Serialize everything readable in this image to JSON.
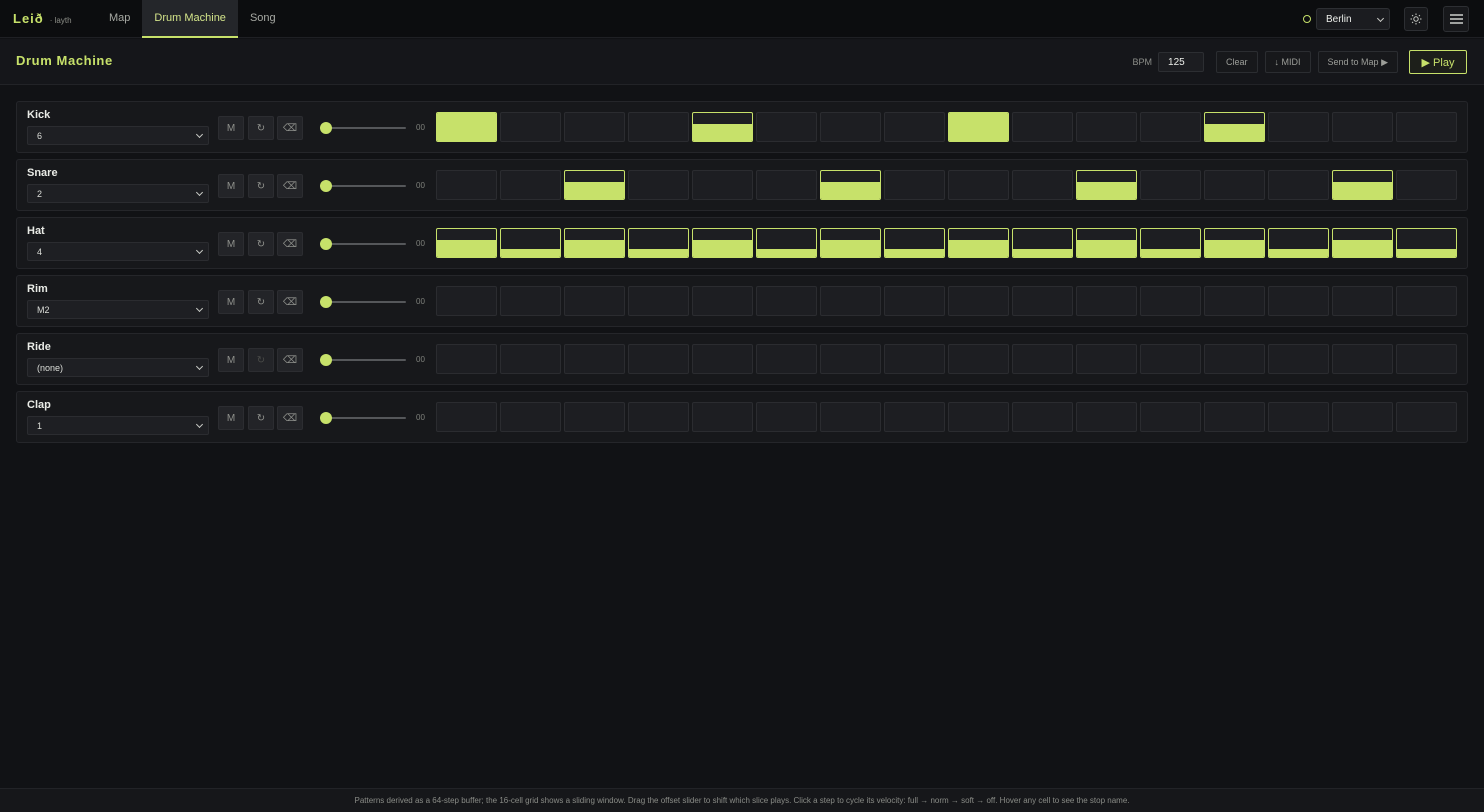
{
  "app": {
    "logo": "Leið",
    "logo_sub": "· layth"
  },
  "nav": {
    "tabs": [
      {
        "label": "Map",
        "active": false
      },
      {
        "label": "Drum Machine",
        "active": true
      },
      {
        "label": "Song",
        "active": false
      }
    ]
  },
  "city": {
    "selected": "Berlin"
  },
  "page": {
    "title": "Drum Machine"
  },
  "controls": {
    "bpm_label": "BPM",
    "bpm_value": "125",
    "clear_label": "Clear",
    "midi_label": "↓ MIDI",
    "send_label": "Send to Map ▶",
    "play_label": "▶ Play"
  },
  "colors": {
    "accent": "#c7e16a",
    "background": "#111215"
  },
  "tracks": [
    {
      "name": "Kick",
      "selected": "6",
      "mute": "M",
      "loop": "↻",
      "clear": "⌫",
      "loop_enabled": true,
      "offset": "00",
      "offset_fraction": 0.0,
      "steps": [
        1,
        0,
        0,
        0,
        0.6,
        0,
        0,
        0,
        1,
        0,
        0,
        0,
        0.6,
        0,
        0,
        0
      ]
    },
    {
      "name": "Snare",
      "selected": "2",
      "mute": "M",
      "loop": "↻",
      "clear": "⌫",
      "loop_enabled": true,
      "offset": "00",
      "offset_fraction": 0.0,
      "steps": [
        0,
        0,
        0.6,
        0,
        0,
        0,
        0.6,
        0,
        0,
        0,
        0.6,
        0,
        0,
        0,
        0.6,
        0
      ]
    },
    {
      "name": "Hat",
      "selected": "4",
      "mute": "M",
      "loop": "↻",
      "clear": "⌫",
      "loop_enabled": true,
      "offset": "00",
      "offset_fraction": 0.0,
      "steps": [
        0.6,
        0.3,
        0.6,
        0.3,
        0.6,
        0.3,
        0.6,
        0.3,
        0.6,
        0.3,
        0.6,
        0.3,
        0.6,
        0.3,
        0.6,
        0.3
      ]
    },
    {
      "name": "Rim",
      "selected": "M2",
      "mute": "M",
      "loop": "↻",
      "clear": "⌫",
      "loop_enabled": true,
      "offset": "00",
      "offset_fraction": 0.0,
      "steps": [
        0,
        0,
        0,
        0,
        0,
        0,
        0,
        0,
        0,
        0,
        0,
        0,
        0,
        0,
        0,
        0
      ]
    },
    {
      "name": "Ride",
      "selected": "(none)",
      "mute": "M",
      "loop": "↻",
      "clear": "⌫",
      "loop_enabled": false,
      "offset": "00",
      "offset_fraction": 0.0,
      "steps": [
        0,
        0,
        0,
        0,
        0,
        0,
        0,
        0,
        0,
        0,
        0,
        0,
        0,
        0,
        0,
        0
      ]
    },
    {
      "name": "Clap",
      "selected": "1",
      "mute": "M",
      "loop": "↻",
      "clear": "⌫",
      "loop_enabled": true,
      "offset": "00",
      "offset_fraction": 0.0,
      "steps": [
        0,
        0,
        0,
        0,
        0,
        0,
        0,
        0,
        0,
        0,
        0,
        0,
        0,
        0,
        0,
        0
      ]
    }
  ],
  "footer": {
    "text": "Patterns derived as a 64-step buffer; the 16-cell grid shows a sliding window. Drag the offset slider to shift which slice plays. Click a step to cycle its velocity: full → norm → soft → off. Hover any cell to see the stop name."
  }
}
